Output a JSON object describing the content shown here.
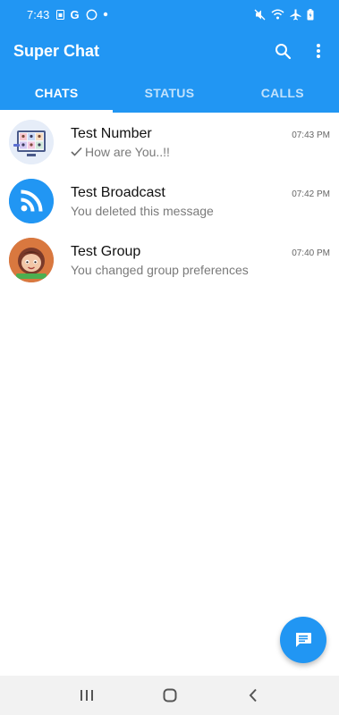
{
  "status_bar": {
    "time": "7:43",
    "left_icons": [
      "sim-icon",
      "google-icon",
      "whatsapp-icon",
      "dot-icon"
    ],
    "right_icons": [
      "mute-icon",
      "wifi-icon",
      "airplane-icon",
      "battery-icon"
    ]
  },
  "app_bar": {
    "title": "Super Chat",
    "actions": [
      "search-icon",
      "more-vert-icon"
    ],
    "color": "#2196F3"
  },
  "tabs": [
    {
      "label": "CHATS",
      "active": true
    },
    {
      "label": "STATUS",
      "active": false
    },
    {
      "label": "CALLS",
      "active": false
    }
  ],
  "chats": [
    {
      "name": "Test Number",
      "time": "07:43 PM",
      "message": "How are You..!!",
      "read_check": true
    },
    {
      "name": "Test Broadcast",
      "time": "07:42 PM",
      "message": "You deleted this message"
    },
    {
      "name": "Test Group",
      "time": "07:40 PM",
      "message": "You changed group preferences"
    }
  ],
  "fab": {
    "icon": "message-icon"
  },
  "nav_bar": {
    "buttons": [
      "recent-apps-icon",
      "home-icon",
      "back-icon"
    ]
  }
}
